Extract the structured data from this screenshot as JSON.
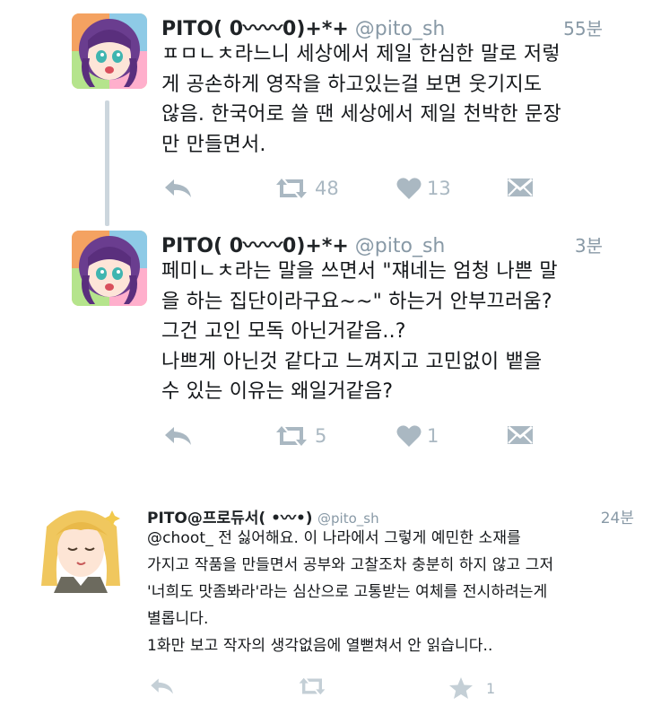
{
  "tweets": [
    {
      "display_name": "PITO( 0‮‬〰〰0)+*+",
      "display_name_plain": "PITO( 0〰〰0)+*+",
      "handle": "@pito_sh",
      "time": "55분",
      "lines": [
        "ㅍㅁㄴㅊ라느니 세상에서 제일 한심한 말로 저렇",
        "게 공손하게 영작을 하고있는걸 보면 웃기지도",
        "않음. 한국어로 쓸 땐 세상에서 제일 천박한 문장",
        "만 만들면서."
      ],
      "retweets": "48",
      "likes": "13"
    },
    {
      "display_name_plain": "PITO( 0〰〰0)+*+",
      "handle": "@pito_sh",
      "time": "3분",
      "lines": [
        "페미ㄴㅊ라는 말을 쓰면서 \"쟤네는 엄청 나쁜 말",
        "을 하는 집단이라구요~~\" 하는거 안부끄러움?",
        "그건 고인 모독 아닌거같음..?",
        "나쁘게 아닌것 같다고 느껴지고 고민없이 뱉을",
        "수 있는 이유는 왜일거같음?"
      ],
      "retweets": "5",
      "likes": "1"
    },
    {
      "display_name_plain": "PITO@프로듀서( •〰•)",
      "handle": "@pito_sh",
      "time": "24분",
      "lines": [
        "@choot_ 전 싫어해요. 이 나라에서 그렇게 예민한 소재를",
        "가지고 작품을 만들면서 공부와 고찰조차 충분히 하지 않고 그저",
        "'너희도 맛좀봐라'라는 심산으로 고통받는 여체를 전시하려는게",
        "별롭니다.",
        "1화만 보고 작자의 생각없음에 열뻗쳐서 안 읽습니다.."
      ],
      "favorites": "1"
    }
  ],
  "icons": {
    "reply": "reply-icon",
    "retweet": "retweet-icon",
    "like": "heart-icon",
    "favorite": "star-icon",
    "message": "direct-message-icon"
  },
  "colors": {
    "action_gray": "#aab8c2",
    "handle_gray": "#8899a6",
    "thread_line": "#ccd6dd"
  }
}
